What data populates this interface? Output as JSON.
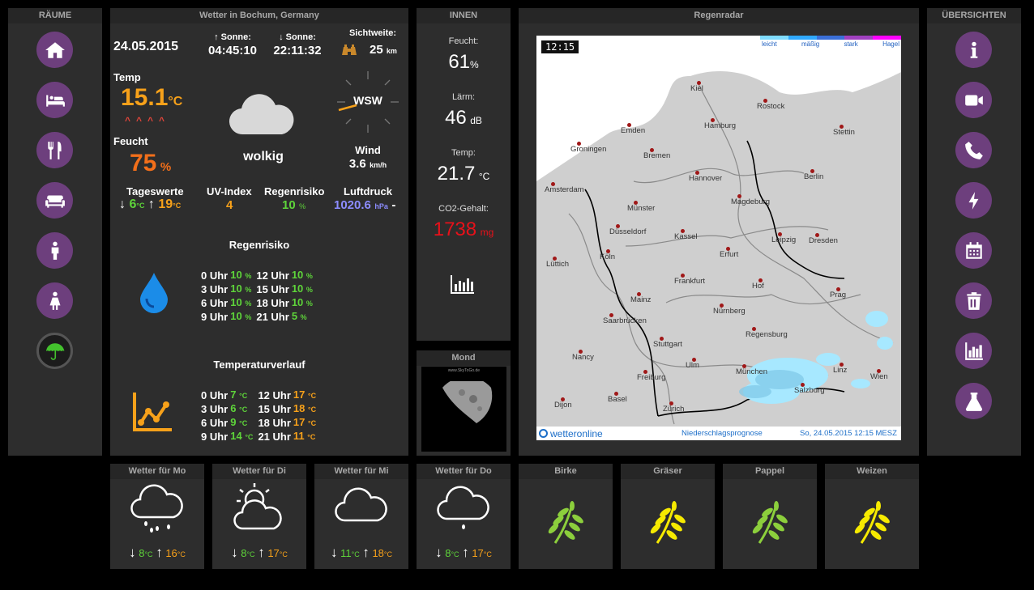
{
  "panels": {
    "rooms_title": "RÄUME",
    "weather_title": "Wetter in Bochum, Germany",
    "inside_title": "INNEN",
    "radar_title": "Regenradar",
    "overview_title": "ÜBERSICHTEN",
    "moon_title": "Mond"
  },
  "rooms": [
    "home-icon",
    "bed-icon",
    "dining-icon",
    "sofa-icon",
    "male-icon",
    "female-icon",
    "umbrella-icon"
  ],
  "overviews": [
    "info-icon",
    "camera-icon",
    "phone-icon",
    "lightning-icon",
    "calendar-icon",
    "trash-icon",
    "chart-icon",
    "flask-icon"
  ],
  "weather": {
    "date": "24.05.2015",
    "sunrise_label": "Sonne:",
    "sunrise": "04:45:10",
    "sunset_label": "Sonne:",
    "sunset": "22:11:32",
    "visibility_label": "Sichtweite:",
    "visibility": "25",
    "visibility_unit": "km",
    "temp_label": "Temp",
    "temp": "15.1",
    "temp_unit": "°C",
    "humidity_label": "Feucht",
    "humidity": "75",
    "humidity_unit": "%",
    "condition": "wolkig",
    "wind_dir": "WSW",
    "wind_label": "Wind",
    "wind_speed": "3.6",
    "wind_unit": "km/h",
    "day_label": "Tageswerte",
    "day_min": "6",
    "day_max": "19",
    "deg_unit": "°C",
    "uv_label": "UV-Index",
    "uv": "4",
    "rainrisk_label": "Regenrisiko",
    "rainrisk": "10",
    "pct": "%",
    "pressure_label": "Luftdruck",
    "pressure": "1020.6",
    "pressure_unit": "hPa",
    "pressure_trend": "-",
    "rain_section": "Regenrisiko",
    "rain_rows": [
      {
        "t1": "0 Uhr",
        "v1": "10",
        "t2": "12 Uhr",
        "v2": "10"
      },
      {
        "t1": "3 Uhr",
        "v1": "10",
        "t2": "15 Uhr",
        "v2": "10"
      },
      {
        "t1": "6 Uhr",
        "v1": "10",
        "t2": "18 Uhr",
        "v2": "10"
      },
      {
        "t1": "9 Uhr",
        "v1": "10",
        "t2": "21 Uhr",
        "v2": "5"
      }
    ],
    "temp_section": "Temperaturverlauf",
    "temp_rows": [
      {
        "t1": "0 Uhr",
        "v1": "7",
        "t2": "12 Uhr",
        "v2": "17"
      },
      {
        "t1": "3 Uhr",
        "v1": "6",
        "t2": "15 Uhr",
        "v2": "18"
      },
      {
        "t1": "6 Uhr",
        "v1": "9",
        "t2": "18 Uhr",
        "v2": "17"
      },
      {
        "t1": "9 Uhr",
        "v1": "14",
        "t2": "21 Uhr",
        "v2": "11"
      }
    ],
    "deg_small": "°C"
  },
  "inside": {
    "humidity_label": "Feucht:",
    "humidity": "61",
    "humidity_unit": "%",
    "noise_label": "Lärm:",
    "noise": "46",
    "noise_unit": "dB",
    "temp_label": "Temp:",
    "temp": "21.7",
    "temp_unit": "°C",
    "co2_label": "CO2-Gehalt:",
    "co2": "1738",
    "co2_unit": "mg"
  },
  "radar": {
    "time": "12:15",
    "legend": [
      "leicht",
      "mäßig",
      "stark",
      "Hagel"
    ],
    "legend_colors": [
      "#7fdcff",
      "#2fa8ff",
      "#3a6fd8",
      "#a040c0",
      "#ff00ff"
    ],
    "brand": "wetteronline",
    "footer_label": "Niederschlagsprognose",
    "footer_date": "So, 24.05.2015 12:15 MESZ",
    "cities": [
      "Kiel",
      "Rostock",
      "Hamburg",
      "Stettin",
      "Emden",
      "Groningen",
      "Bremen",
      "Amsterdam",
      "Hannover",
      "Berlin",
      "Münster",
      "Magdeburg",
      "Düsseldorf",
      "Kassel",
      "Leipzig",
      "Dresden",
      "Köln",
      "Erfurt",
      "Lüttich",
      "Frankfurt",
      "Hof",
      "Prag",
      "Mainz",
      "Nürnberg",
      "Saarbrücken",
      "Regensburg",
      "Stuttgart",
      "Nancy",
      "Ulm",
      "München",
      "Linz",
      "Wien",
      "Freiburg",
      "Salzburg",
      "Basel",
      "Dijon",
      "Zürich"
    ]
  },
  "moon": {
    "caption": "www.SkyToGo.de"
  },
  "forecast": [
    {
      "title": "Wetter für Mo",
      "min": "8",
      "max": "16",
      "icon": "rain-cloud-icon"
    },
    {
      "title": "Wetter für Di",
      "min": "8",
      "max": "17",
      "icon": "sun-cloud-icon"
    },
    {
      "title": "Wetter für Mi",
      "min": "11",
      "max": "18",
      "icon": "cloud-icon"
    },
    {
      "title": "Wetter für Do",
      "min": "8",
      "max": "17",
      "icon": "drizzle-cloud-icon"
    }
  ],
  "pollen": [
    {
      "title": "Birke",
      "color": "#8ccf3c"
    },
    {
      "title": "Gräser",
      "color": "#f6ea00"
    },
    {
      "title": "Pappel",
      "color": "#8ccf3c"
    },
    {
      "title": "Weizen",
      "color": "#f6ea00"
    }
  ]
}
